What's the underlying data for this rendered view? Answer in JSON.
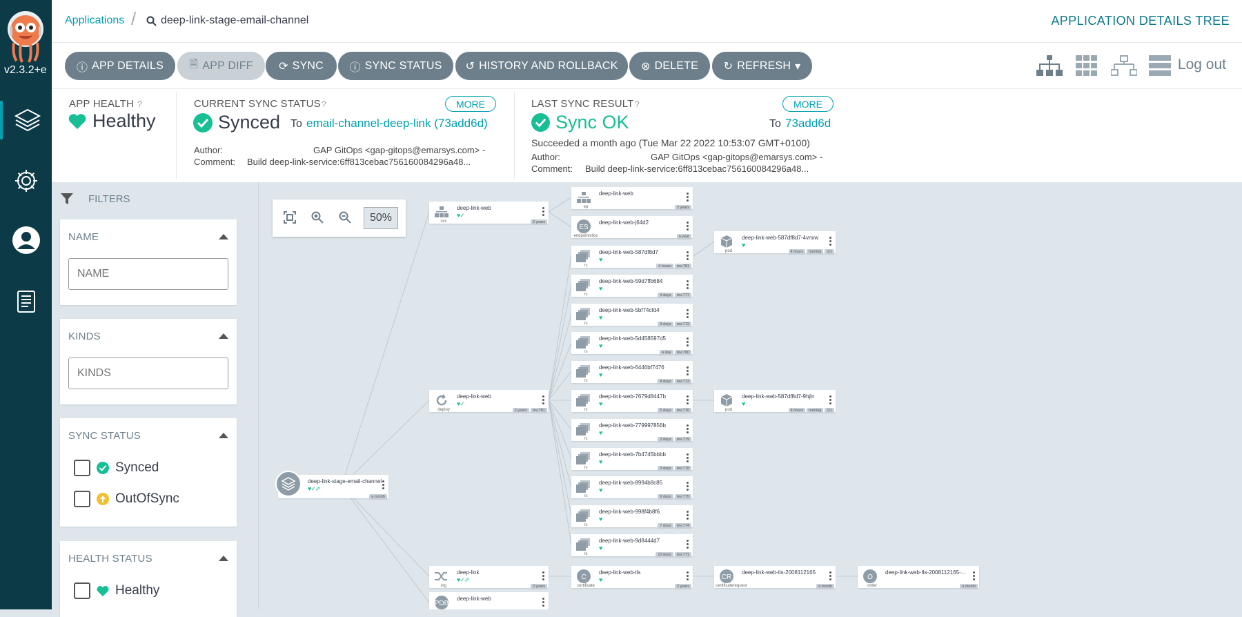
{
  "sidebar": {
    "version": "v2.3.2+e"
  },
  "breadcrumb": {
    "applications": "Applications",
    "current": "deep-link-stage-email-channel"
  },
  "header": {
    "title": "APPLICATION DETAILS TREE"
  },
  "toolbar": {
    "app_details": "APP DETAILS",
    "app_diff": "APP DIFF",
    "sync": "SYNC",
    "sync_status": "SYNC STATUS",
    "history": "HISTORY AND ROLLBACK",
    "delete": "DELETE",
    "refresh": "REFRESH",
    "logout": "Log out"
  },
  "app_health": {
    "label": "APP HEALTH",
    "value": "Healthy"
  },
  "current_sync": {
    "label": "CURRENT SYNC STATUS",
    "more": "MORE",
    "value": "Synced",
    "to_label": "To",
    "to_value": "email-channel-deep-link (73add6d)",
    "author_label": "Author:",
    "author": "GAP GitOps <gap-gitops@emarsys.com> -",
    "comment_label": "Comment:",
    "comment": "Build deep-link-service:6ff813cebac756160084296a48..."
  },
  "last_sync": {
    "label": "LAST SYNC RESULT",
    "more": "MORE",
    "value": "Sync OK",
    "to_label": "To",
    "to_value": "73add6d",
    "succeeded": "Succeeded a month ago (Tue Mar 22 2022 10:53:07 GMT+0100)",
    "author_label": "Author:",
    "author": "GAP GitOps <gap-gitops@emarsys.com> -",
    "comment_label": "Comment:",
    "comment": "Build deep-link-service:6ff813cebac756160084296a48..."
  },
  "filters": {
    "title": "FILTERS",
    "name": {
      "title": "NAME",
      "placeholder": "NAME"
    },
    "kinds": {
      "title": "KINDS",
      "placeholder": "KINDS"
    },
    "sync_status": {
      "title": "SYNC STATUS",
      "synced": "Synced",
      "out_of_sync": "OutOfSync"
    },
    "health_status": {
      "title": "HEALTH STATUS",
      "healthy": "Healthy"
    }
  },
  "zoom": {
    "level": "50%"
  },
  "nodes": {
    "app": {
      "name": "deep-link-stage-email-channel",
      "tags": [
        "a month"
      ]
    },
    "svc": {
      "name": "deep-link-web",
      "kind": "svc",
      "tags": [
        "2 years"
      ]
    },
    "deploy": {
      "name": "deep-link-web",
      "kind": "deploy",
      "tags": [
        "2 years",
        "rev:781"
      ]
    },
    "ing": {
      "name": "deep-link",
      "kind": "ing",
      "tags": [
        "2 years"
      ]
    },
    "pdb": {
      "name": "deep-link-web",
      "kind": "PDB"
    },
    "ep": {
      "name": "deep-link-web",
      "kind": "ep",
      "tags": [
        "2 years"
      ]
    },
    "endpointslice": {
      "name": "deep-link-web-j64d2",
      "kind": "endpointslice",
      "tags": [
        "a year"
      ]
    },
    "certificate": {
      "name": "deep-link-web-tls",
      "kind": "certificate",
      "tags": [
        "2 years"
      ]
    },
    "certificaterequest": {
      "name": "deep-link-web-tls-2008112165",
      "kind": "certificaterequest",
      "tags": [
        "a month"
      ]
    },
    "order": {
      "name": "deep-link-web-tls-2008112165-...",
      "kind": "order",
      "tags": [
        "a month"
      ]
    },
    "pod1": {
      "name": "deep-link-web-587df8d7-4vnxw",
      "kind": "pod",
      "tags": [
        "4 hours",
        "running",
        "1/1"
      ]
    },
    "pod2": {
      "name": "deep-link-web-587df8d7-9hjln",
      "kind": "pod",
      "tags": [
        "4 hours",
        "running",
        "1/1"
      ]
    },
    "rs": [
      {
        "name": "deep-link-web-587df8d7",
        "tags": [
          "4 hours",
          "rev:781"
        ]
      },
      {
        "name": "deep-link-web-59d7ffb684",
        "tags": [
          "4 days",
          "rev:777"
        ]
      },
      {
        "name": "deep-link-web-5bf74cfd4",
        "tags": [
          "9 days",
          "rev:772"
        ]
      },
      {
        "name": "deep-link-web-5d458597d5",
        "tags": [
          "a day",
          "rev:780"
        ]
      },
      {
        "name": "deep-link-web-6446bf7476",
        "tags": [
          "8 days",
          "rev:773"
        ]
      },
      {
        "name": "deep-link-web-7679d8447b",
        "tags": [
          "5 days",
          "rev:776"
        ]
      },
      {
        "name": "deep-link-web-779997856b",
        "tags": [
          "2 days",
          "rev:779"
        ]
      },
      {
        "name": "deep-link-web-7b4745bbbb",
        "tags": [
          "3 days",
          "rev:778"
        ]
      },
      {
        "name": "deep-link-web-8994b8c85",
        "tags": [
          "6 days",
          "rev:775"
        ]
      },
      {
        "name": "deep-link-web-998f4b8f6",
        "tags": [
          "7 days",
          "rev:774"
        ]
      },
      {
        "name": "deep-link-web-9d8444d7",
        "tags": [
          "10 days",
          "rev:771"
        ]
      }
    ],
    "rs_kind": "rs"
  },
  "colors": {
    "teal": "#009fb0",
    "healthy": "#18be94",
    "sidebar": "#0c3a46",
    "button": "#6d7f8b",
    "outofsync": "#f4c030"
  }
}
